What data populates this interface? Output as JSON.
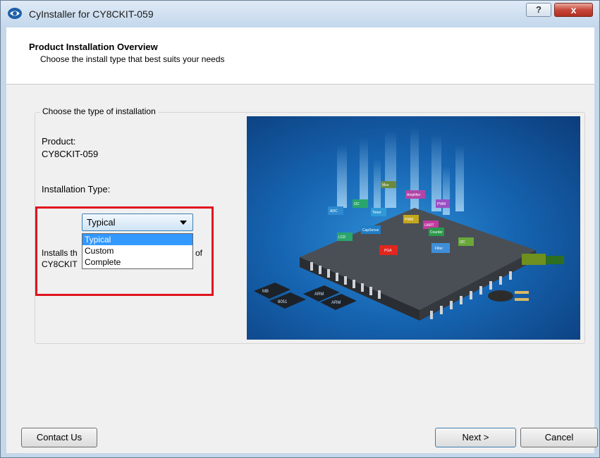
{
  "window": {
    "title": "CyInstaller for CY8CKIT-059",
    "help_label": "?",
    "close_label": "x"
  },
  "header": {
    "title": "Product Installation Overview",
    "subtitle": "Choose the install type that best suits your needs"
  },
  "group": {
    "legend": "Choose the type of installation"
  },
  "product": {
    "label": "Product:",
    "value": "CY8CKIT-059"
  },
  "install_type": {
    "label": "Installation Type:",
    "selected": "Typical",
    "options": [
      "Typical",
      "Custom",
      "Complete"
    ],
    "description_partial_1": "Installs th",
    "description_partial_2": "of",
    "description_partial_3": "CY8CKIT"
  },
  "image": {
    "chip_labels": [
      "ADC",
      "Timer",
      "PWM",
      "PGA",
      "Filter",
      "LCD",
      "UART",
      "CapSense",
      "Amplifier",
      "Counter",
      "I2C",
      "Mux"
    ],
    "pad_labels": [
      "8051",
      "ARM"
    ]
  },
  "buttons": {
    "contact": "Contact Us",
    "next": "Next >",
    "cancel": "Cancel"
  },
  "colors": {
    "accent": "#3399ff",
    "highlight": "#e0141e",
    "image_bg": "#1665b2"
  }
}
